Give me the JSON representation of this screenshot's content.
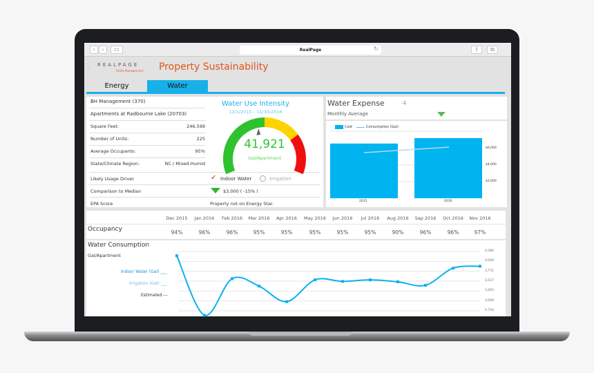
{
  "browser": {
    "url_title": "RealPage"
  },
  "app": {
    "logo": "REALPAGE",
    "logo_sub": "Utility Management",
    "title": "Property Sustainability",
    "tabs": [
      {
        "label": "Energy",
        "active": false
      },
      {
        "label": "Water",
        "active": true
      }
    ],
    "accent": "#17b0e8",
    "title_color": "#e0561a"
  },
  "property": {
    "company": "BH Management (370)",
    "name": "Apartments at Radbourne Lake (20703)",
    "fields": [
      {
        "label": "Square Feet:",
        "value": "246,599"
      },
      {
        "label": "Number of Units:",
        "value": "225"
      },
      {
        "label": "Average Occupants:",
        "value": "95%"
      },
      {
        "label": "State/Climate Region:",
        "value": "NC / Mixed-Humid"
      }
    ],
    "usage_driver_label": "Likely Usage Driver",
    "usage_options": [
      {
        "label": "Indoor Water",
        "checked": true
      },
      {
        "label": "Irrigation",
        "checked": false
      }
    ],
    "comparison_label": "Comparison to Median",
    "comparison_value": "$3,000 ( -15% )",
    "epa_label": "EPA Score",
    "epa_value": "Property not on Energy Star."
  },
  "gauge": {
    "title": "Water Use Intensity",
    "dates": "12/1/2015 - 11/30/2016",
    "value": "41,921",
    "unit": "Gal/Apartment",
    "needle_fraction": 0.45,
    "colors": [
      "#2fc22f",
      "#ffd200",
      "#f00f0f"
    ]
  },
  "expense": {
    "title": "Water Expense",
    "badge": "-1",
    "subtitle": "Monthly Average"
  },
  "chart_data": [
    {
      "type": "bar",
      "legend": [
        "Cost",
        "Consumption (Gal)"
      ],
      "categories": [
        "2015",
        "2016"
      ],
      "series": [
        {
          "name": "Cost",
          "values": [
            6600,
            7250
          ]
        }
      ],
      "y_ticks": [
        "$2,000",
        "$4,000",
        "$6,000"
      ],
      "ylim": [
        0,
        8000
      ],
      "legend_placement": "top-left",
      "colors": {
        "bar": "#00b4f0",
        "line": "#b8d8f0"
      }
    },
    {
      "type": "line",
      "title": "Water Consumption",
      "ylabel": "Gal/Apartment",
      "legend": [
        "Indoor Water (Gal)",
        "Irrigation (Gal)",
        "Estimated"
      ],
      "categories": [
        "Dec 2015",
        "Jan 2016",
        "Feb 2016",
        "Mar 2016",
        "Apr 2016",
        "May 2016",
        "Jun 2016",
        "Jul 2016",
        "Aug 2016",
        "Sep 2016",
        "Oct 2016",
        "Nov 2016"
      ],
      "series": [
        {
          "name": "Indoor Water (Gal)",
          "values": [
            4170,
            2640,
            3580,
            3390,
            2990,
            3550,
            3510,
            3550,
            3500,
            3410,
            3850,
            3900
          ]
        }
      ],
      "y_ticks": [
        "4,280",
        "4,026",
        "3,772",
        "3,517",
        "3,263",
        "3,009",
        "2,754"
      ],
      "ylim": [
        2754,
        4280
      ],
      "grid": true,
      "color": "#0ab0f0"
    }
  ],
  "occupancy": {
    "label": "Occupancy",
    "values": [
      "94%",
      "96%",
      "96%",
      "95%",
      "95%",
      "95%",
      "95%",
      "95%",
      "90%",
      "96%",
      "96%",
      "97%"
    ]
  }
}
